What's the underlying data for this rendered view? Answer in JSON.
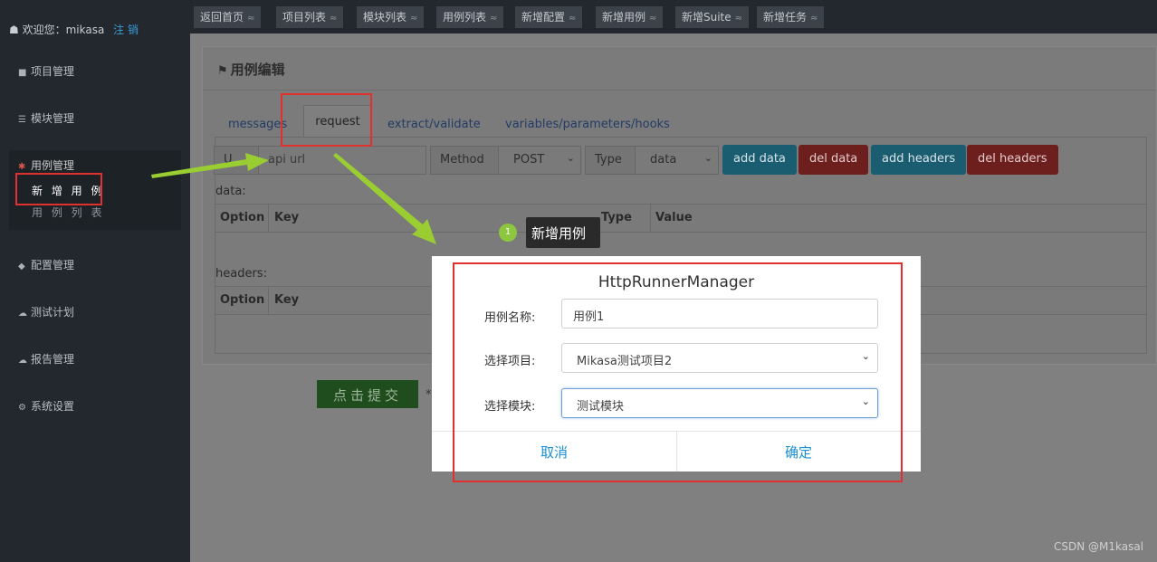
{
  "sidebar": {
    "welcome": "欢迎您：mikasa",
    "logout": "注 销",
    "items": [
      {
        "label": "项目管理",
        "icon": "folder-icon"
      },
      {
        "label": "模块管理",
        "icon": "list-icon"
      },
      {
        "label": "用例管理",
        "icon": "bug-icon"
      },
      {
        "label": "配置管理",
        "icon": "tag-icon"
      },
      {
        "label": "测试计划",
        "icon": "cloud-icon"
      },
      {
        "label": "报告管理",
        "icon": "cloud-download-icon"
      },
      {
        "label": "系统设置",
        "icon": "gears-icon"
      }
    ],
    "sub_items": [
      "新 增 用 例",
      "用 例 列 表"
    ]
  },
  "top_tabs": [
    "返回首页",
    "项目列表",
    "模块列表",
    "用例列表",
    "新增配置",
    "新增用例",
    "新增Suite",
    "新增任务"
  ],
  "panel": {
    "title": "用例编辑",
    "tabs": [
      "messages",
      "request",
      "extract/validate",
      "variables/parameters/hooks"
    ],
    "url_addon": "U",
    "url_placeholder": "api url",
    "method_label": "Method",
    "method_value": "POST",
    "type_label": "Type",
    "type_value": "data",
    "buttons": {
      "add_data": "add data",
      "del_data": "del data",
      "add_headers": "add headers",
      "del_headers": "del headers"
    },
    "data_label": "data:",
    "headers_label": "headers:",
    "columns": {
      "option": "Option",
      "key": "Key",
      "type": "Type",
      "value": "Value"
    },
    "submit": "点击提交",
    "submit_suffix": "*"
  },
  "tooltip": {
    "step": "1",
    "text": "新增用例"
  },
  "modal": {
    "title": "HttpRunnerManager",
    "name_label": "用例名称:",
    "name_value": "用例1",
    "project_label": "选择项目:",
    "project_value": "Mikasa测试项目2",
    "module_label": "选择模块:",
    "module_value": "测试模块",
    "cancel": "取消",
    "confirm": "确定"
  },
  "watermark": "CSDN @M1kasal",
  "colors": {
    "annotation_red": "#e0312f",
    "annotation_arrow": "#9acd32",
    "link_blue": "#1a8fd1"
  }
}
